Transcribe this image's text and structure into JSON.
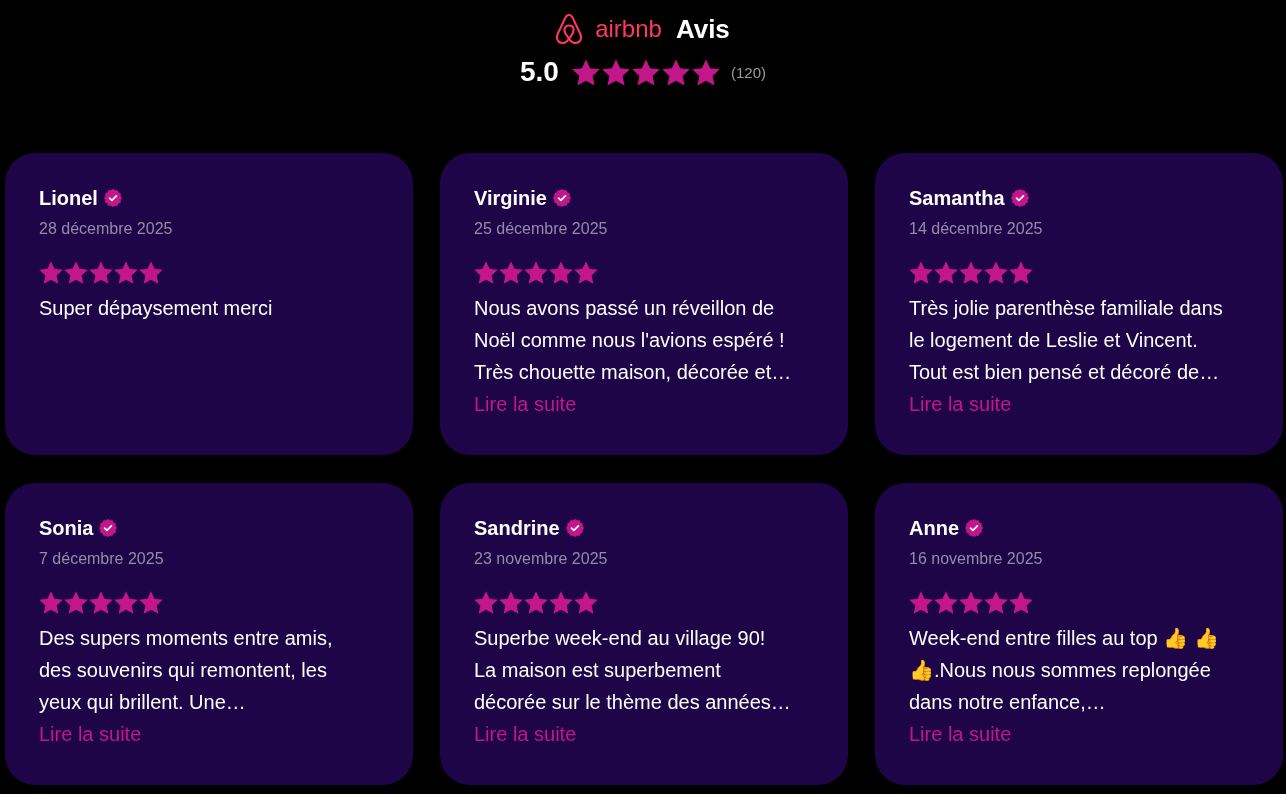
{
  "header": {
    "logo_text": "airbnb",
    "title": "Avis",
    "rating": "5.0",
    "stars": 5,
    "count": "(120)"
  },
  "reviews": [
    {
      "name": "Lionel",
      "verified": true,
      "date": "28 décembre 2025",
      "stars": 5,
      "text": "Super dépaysement merci"
    },
    {
      "name": "Virginie",
      "verified": true,
      "date": "25 décembre 2025",
      "stars": 5,
      "text": "Nous avons passé un réveillon de Noël comme nous l'avions espéré ! Très chouette maison, décorée et…",
      "read_more": "Lire la suite"
    },
    {
      "name": "Samantha",
      "verified": true,
      "date": "14 décembre 2025",
      "stars": 5,
      "text": "Très jolie parenthèse familiale dans le logement de Leslie et Vincent. Tout est bien pensé et décoré de…",
      "read_more": "Lire la suite"
    },
    {
      "name": "Sonia",
      "verified": true,
      "date": "7 décembre 2025",
      "stars": 5,
      "text": "Des supers moments entre amis, des souvenirs qui remontent, les yeux qui brillent. Une…",
      "read_more": "Lire la suite"
    },
    {
      "name": "Sandrine",
      "verified": true,
      "date": "23 novembre 2025",
      "stars": 5,
      "text": "Superbe week-end au village 90! La maison est superbement décorée sur le thème des années…",
      "read_more": "Lire la suite"
    },
    {
      "name": "Anne",
      "verified": true,
      "date": "16 novembre 2025",
      "stars": 5,
      "text": "Week-end entre filles au top 👍 👍 👍.Nous nous sommes replongée dans notre enfance,…",
      "read_more": "Lire la suite"
    }
  ]
}
